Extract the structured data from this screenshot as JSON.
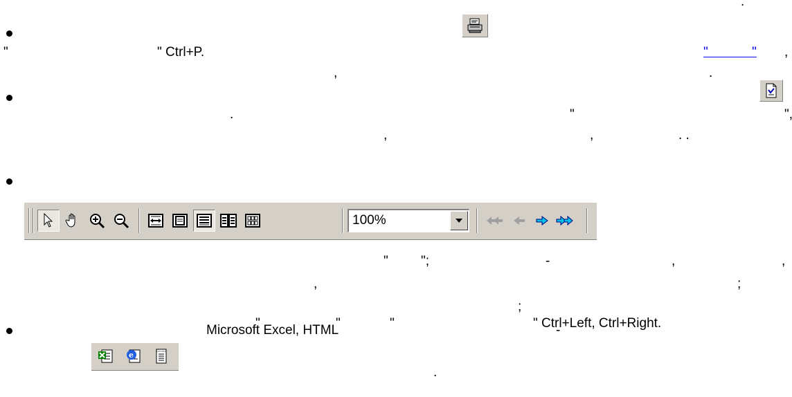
{
  "text": {
    "p1_dot": ".",
    "p2_quote": "\"",
    "p2_ctrlp": "\" Ctrl+P.",
    "p2_link": "\"            \"",
    "p2_comma": ",",
    "p3_comma": ",",
    "p3_dot": ".",
    "p4_dot": ".",
    "p4_quote": "\"",
    "p4_quote_comma": "\",",
    "p5_comma1": ",",
    "p5_comma2": ",",
    "p5_dots": ". .",
    "p6_quote": "\"",
    "p6_quote_semicolon": "\";",
    "p6_dash": "-",
    "p6_comma1": ",",
    "p6_comma2": ",",
    "p7_comma": ",",
    "p7_semicolon": ";",
    "p8_semicolon": ";",
    "p9_quote1": "\"",
    "p9_quote2": "\"",
    "p9_quote3": "\"",
    "p9_shortcuts": "\" Ctrl+Left, Ctrl+Right.",
    "p10_formats": "Microsoft Excel, HTML",
    "p10_dash": "-",
    "p11_dot": "."
  },
  "toolbar": {
    "zoom_value": "100%",
    "tools": [
      "select-arrow",
      "hand-pan",
      "zoom-in",
      "zoom-out"
    ],
    "views": [
      "page-width",
      "whole-page",
      "single-page",
      "two-pages",
      "multiple-pages"
    ],
    "nav": [
      "first-page",
      "previous-page",
      "next-page",
      "last-page"
    ]
  },
  "icons": {
    "print": "printer-icon",
    "setup": "page-setup-icon",
    "export": [
      "excel-icon",
      "html-icon",
      "text-icon"
    ]
  },
  "colors": {
    "link": "#0000ee",
    "toolbar_bg": "#d4d0c8",
    "nav_disabled": "#a0a0a0",
    "nav_enabled": "#00c0e8"
  }
}
